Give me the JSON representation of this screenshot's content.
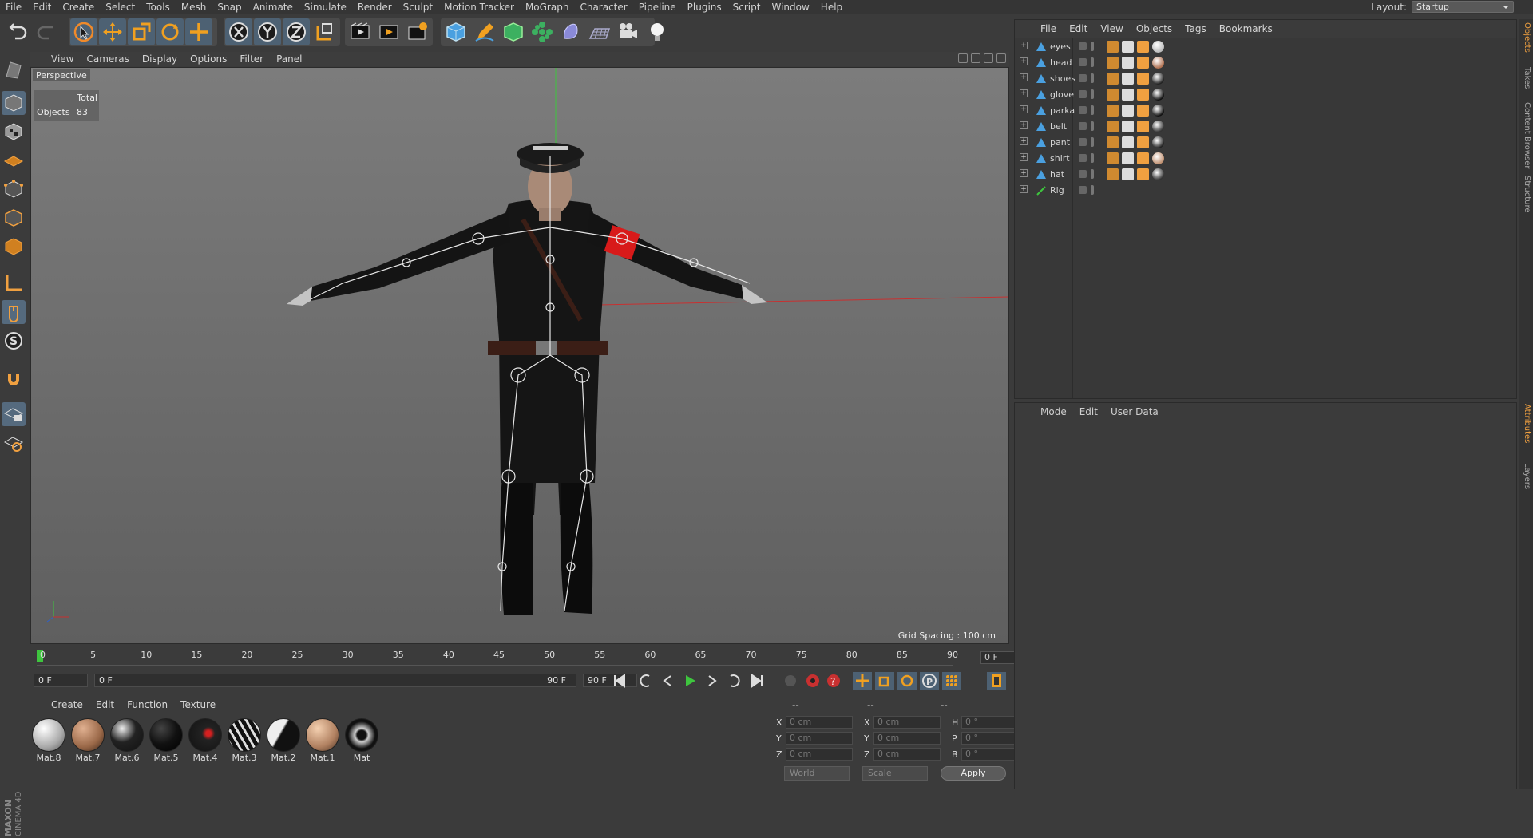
{
  "menu": [
    "File",
    "Edit",
    "Create",
    "Select",
    "Tools",
    "Mesh",
    "Snap",
    "Animate",
    "Simulate",
    "Render",
    "Sculpt",
    "Motion Tracker",
    "MoGraph",
    "Character",
    "Pipeline",
    "Plugins",
    "Script",
    "Window",
    "Help"
  ],
  "layout": {
    "label": "Layout:",
    "value": "Startup"
  },
  "toolbar_icons": [
    "undo-icon",
    "redo-icon",
    "live-selection-icon",
    "move-icon",
    "scale-icon",
    "rotate-icon",
    "recent-tools-icon",
    "x-axis-icon",
    "y-axis-icon",
    "z-axis-icon",
    "coordinate-system-icon",
    "render-view-icon",
    "render-picture-viewer-icon",
    "edit-render-settings-icon",
    "cube-icon",
    "pen-icon",
    "subdivision-icon",
    "cloner-icon",
    "deformer-icon",
    "floor-icon",
    "camera-icon",
    "light-icon"
  ],
  "viewport": {
    "menu": [
      "View",
      "Cameras",
      "Display",
      "Options",
      "Filter",
      "Panel"
    ],
    "label": "Perspective",
    "hud_header": "Total",
    "hud_label": "Objects",
    "hud_value": "83",
    "grid_spacing": "Grid Spacing : 100 cm"
  },
  "timeline": {
    "ticks": [
      "0",
      "5",
      "10",
      "15",
      "20",
      "25",
      "30",
      "35",
      "40",
      "45",
      "50",
      "55",
      "60",
      "65",
      "70",
      "75",
      "80",
      "85",
      "90"
    ],
    "current": "0 F"
  },
  "transport": {
    "start": "0 F",
    "range_start": "0 F",
    "range_end": "90 F",
    "end": "90 F"
  },
  "materials": {
    "menu": [
      "Create",
      "Edit",
      "Function",
      "Texture"
    ],
    "items": [
      "Mat.8",
      "Mat.7",
      "Mat.6",
      "Mat.5",
      "Mat.4",
      "Mat.3",
      "Mat.2",
      "Mat.1",
      "Mat"
    ]
  },
  "coords": {
    "headers": [
      "--",
      "--",
      "--"
    ],
    "rows": [
      [
        "X",
        "0 cm",
        "X",
        "0 cm",
        "H",
        "0 °"
      ],
      [
        "Y",
        "0 cm",
        "Y",
        "0 cm",
        "P",
        "0 °"
      ],
      [
        "Z",
        "0 cm",
        "Z",
        "0 cm",
        "B",
        "0 °"
      ]
    ],
    "world": "World",
    "scale": "Scale",
    "apply": "Apply"
  },
  "objects": {
    "menu": [
      "File",
      "Edit",
      "View",
      "Objects",
      "Tags",
      "Bookmarks"
    ],
    "items": [
      "eyes",
      "head",
      "shoes",
      "glove",
      "parka",
      "belt",
      "pant",
      "shirt",
      "hat",
      "Rig"
    ]
  },
  "attributes": {
    "menu": [
      "Mode",
      "Edit",
      "User Data"
    ]
  },
  "right_tabs": [
    "Objects",
    "Takes",
    "Content Browser",
    "Structure",
    "Attributes",
    "Layers"
  ],
  "brand": "MAXON CINEMA 4D",
  "colors": {
    "highlight": "#4d6173",
    "accent": "#f0a040"
  }
}
